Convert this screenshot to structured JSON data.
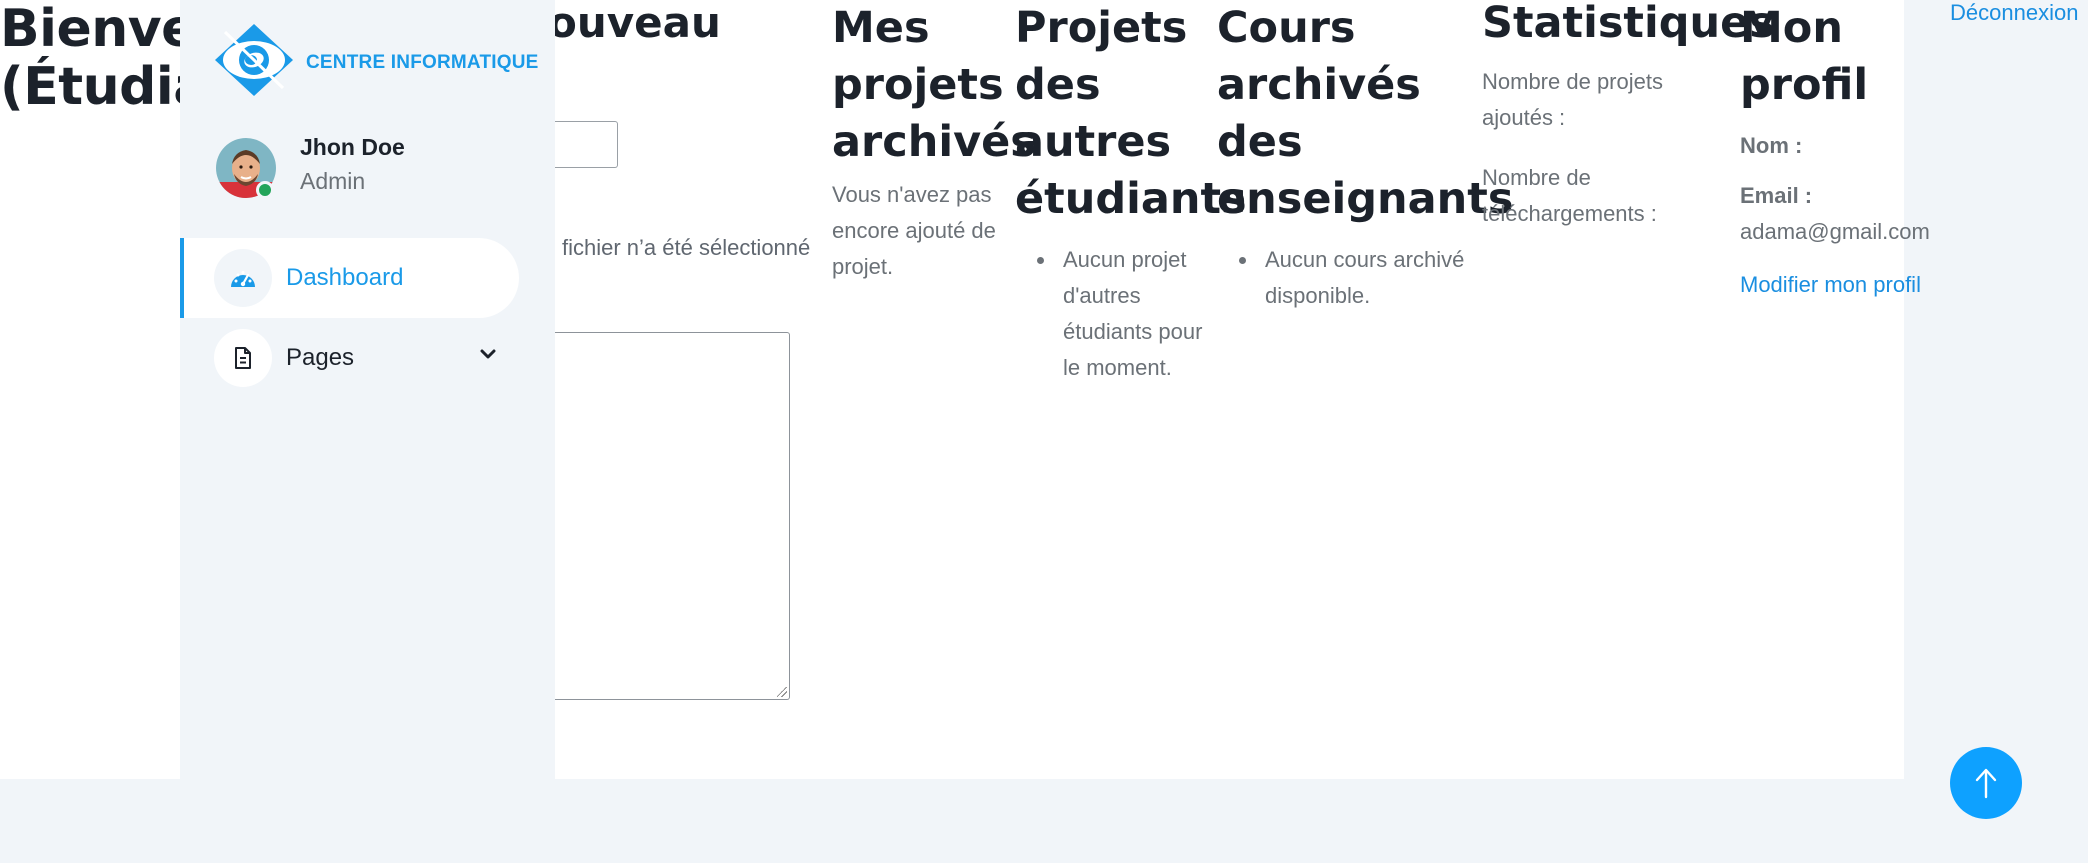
{
  "main": {
    "welcome_title": "Bienve\n(Étudia",
    "new_project_title": "ouveau",
    "file_status": "fichier n’a été sélectionné",
    "archived": {
      "title": "Mes projets archivés",
      "empty_text": "Vous n'avez pas encore ajouté de projet."
    },
    "others": {
      "title": "Projets des autres étudiants",
      "items": [
        "Aucun projet d'autres étudiants pour le moment."
      ]
    },
    "courses": {
      "title": "Cours archivés des enseignants",
      "items": [
        "Aucun cours archivé disponible."
      ]
    },
    "stats": {
      "title": "Statistiques",
      "projects_label": "Nombre de projets ajoutés :",
      "downloads_label": "Nombre de téléchargements :"
    },
    "profile": {
      "title": "Mon profil",
      "name_label": "Nom :",
      "email_label": "Email :",
      "email_value": "adama@gmail.com",
      "edit_link": "Modifier mon profil"
    },
    "logout": "Déconnexion"
  },
  "sidebar": {
    "brand": "CENTRE INFORMATIQUE",
    "user": {
      "name": "Jhon Doe",
      "role": "Admin",
      "status": "online"
    },
    "items": [
      {
        "label": "Dashboard",
        "icon": "speedometer-icon",
        "active": true
      },
      {
        "label": "Pages",
        "icon": "document-icon",
        "expandable": true
      }
    ]
  },
  "colors": {
    "accent": "#1a9ae8",
    "scroll_button": "#0ea1ff",
    "online": "#22a45a",
    "sidebar_bg": "#f1f5f9"
  }
}
